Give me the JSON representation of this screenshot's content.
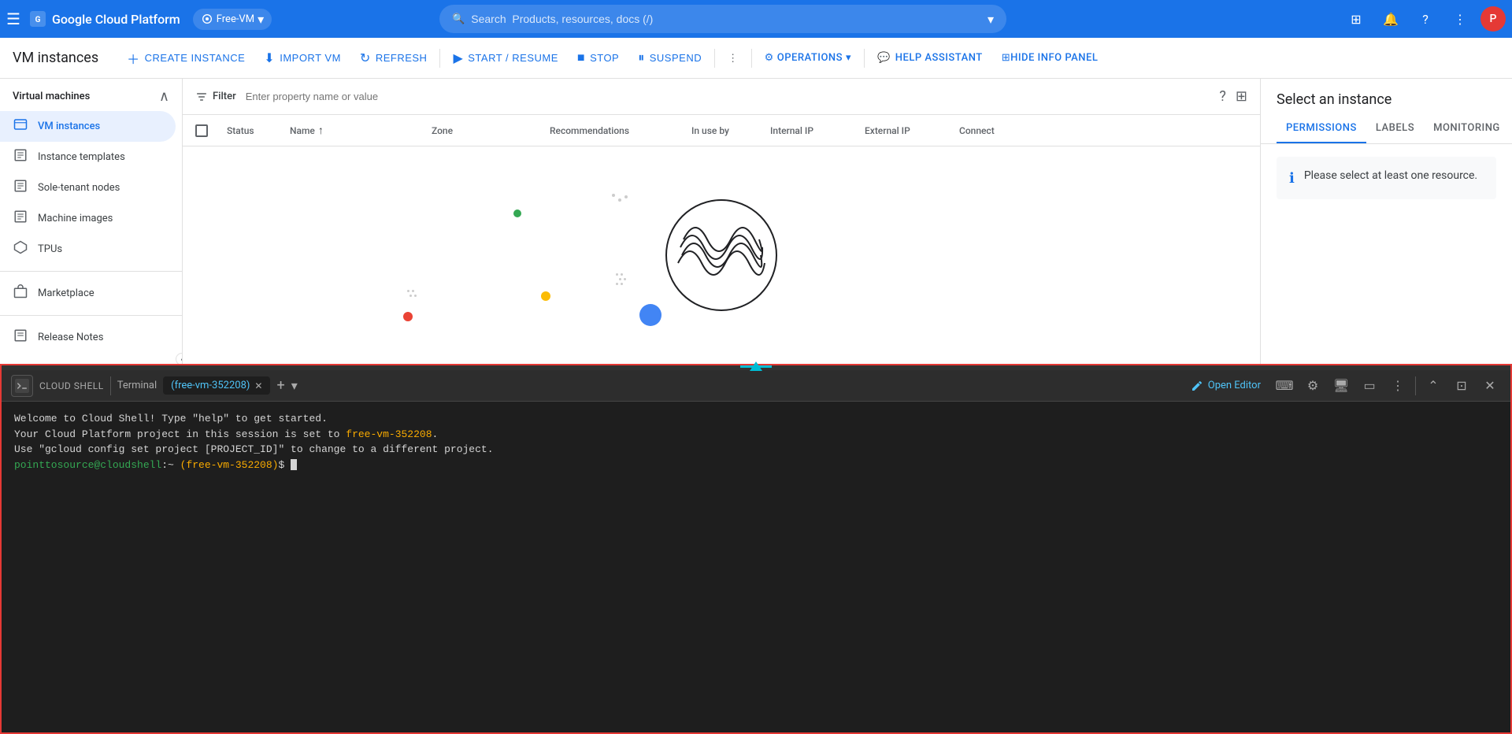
{
  "topnav": {
    "menu_icon": "☰",
    "brand": "Google Cloud Platform",
    "project": "Free-VM",
    "search_placeholder": "Search  Products, resources, docs (/)",
    "avatar_label": "P",
    "avatar_bg": "#e53935"
  },
  "toolbar": {
    "page_title": "VM instances",
    "create_instance": "CREATE INSTANCE",
    "import_vm": "IMPORT VM",
    "refresh": "REFRESH",
    "start_resume": "START / RESUME",
    "stop": "STOP",
    "suspend": "SUSPEND",
    "operations": "OPERATIONS",
    "help_assistant": "HELP ASSISTANT",
    "hide_info_panel": "HIDE INFO PANEL"
  },
  "sidebar": {
    "section_label": "Virtual machines",
    "items": [
      {
        "label": "VM instances",
        "icon": "▦",
        "active": true
      },
      {
        "label": "Instance templates",
        "icon": "☰",
        "active": false
      },
      {
        "label": "Sole-tenant nodes",
        "icon": "☰",
        "active": false
      },
      {
        "label": "Machine images",
        "icon": "☰",
        "active": false
      },
      {
        "label": "TPUs",
        "icon": "✦",
        "active": false
      },
      {
        "label": "Marketplace",
        "icon": "🛒",
        "active": false
      }
    ],
    "release_notes": "Release Notes",
    "collapse_icon": "‹"
  },
  "filter_bar": {
    "label": "Filter",
    "placeholder": "Enter property name or value"
  },
  "table": {
    "columns": [
      "",
      "Status",
      "Name",
      "Zone",
      "Recommendations",
      "In use by",
      "Internal IP",
      "External IP",
      "Connect"
    ]
  },
  "info_panel": {
    "title": "Select an instance",
    "tabs": [
      {
        "label": "PERMISSIONS",
        "active": true
      },
      {
        "label": "LABELS",
        "active": false
      },
      {
        "label": "MONITORING",
        "active": false
      }
    ],
    "notice": "Please select at least one resource."
  },
  "cloud_shell": {
    "label": "CLOUD SHELL",
    "terminal_tab": "Terminal",
    "session_tab": "(free-vm-352208)",
    "open_editor": "Open Editor",
    "terminal_lines": [
      {
        "text": "Welcome to Cloud Shell! Type \"help\" to get started.",
        "color": "normal"
      },
      {
        "text": "Your Cloud Platform project in this session is set to ",
        "color": "normal",
        "highlight": "free-vm-352208",
        "suffix": "."
      },
      {
        "text": "Use \"gcloud config set project [PROJECT_ID]\" to change to a different project.",
        "color": "normal"
      },
      {
        "text": "pointtosource@cloudshell:~ (free-vm-352208)$ ",
        "color": "prompt",
        "has_cursor": true
      }
    ]
  }
}
